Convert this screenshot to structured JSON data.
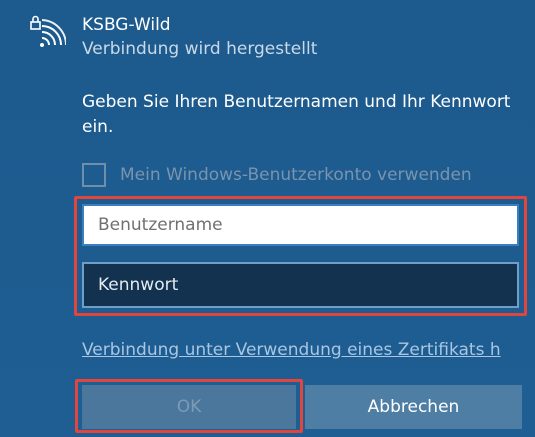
{
  "network": {
    "icon": "secured-wifi-icon",
    "name": "KSBG-Wild",
    "status": "Verbindung wird hergestellt"
  },
  "prompt": {
    "text": "Geben Sie Ihren Benutzernamen und Ihr Kennwort ein."
  },
  "windows_account": {
    "label": "Mein Windows-Benutzerkonto verwenden",
    "checked": false
  },
  "fields": {
    "username_placeholder": "Benutzername",
    "username_value": "",
    "password_placeholder": "Kennwort",
    "password_value": ""
  },
  "certificate_link": "Verbindung unter Verwendung eines Zertifikats h",
  "buttons": {
    "ok_label": "OK",
    "cancel_label": "Abbrechen"
  },
  "colors": {
    "background": "#1f5a8c",
    "highlight": "#e0453e",
    "password_field": "#12324f"
  }
}
